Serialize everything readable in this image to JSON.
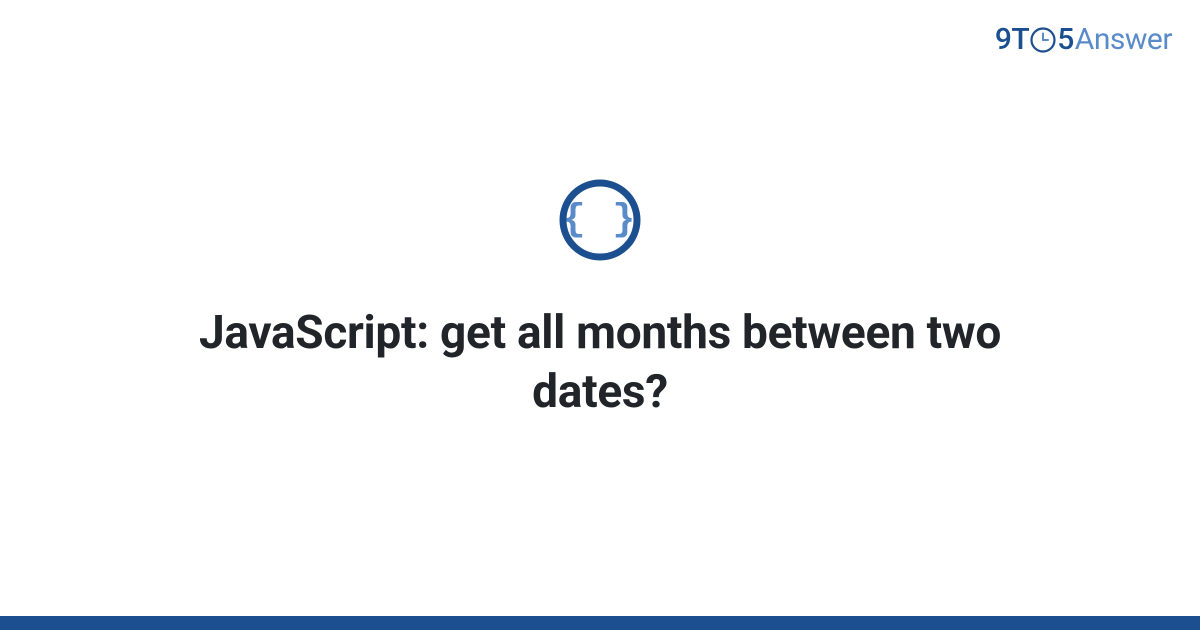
{
  "brand": {
    "part1": "9T",
    "part2": "5",
    "part3": "Answer"
  },
  "main": {
    "topic_icon_name": "code-braces-icon",
    "title": "JavaScript: get all months between two dates?"
  },
  "colors": {
    "primary": "#1b4f8f",
    "secondary": "#5a8bc9",
    "text": "#212529"
  }
}
